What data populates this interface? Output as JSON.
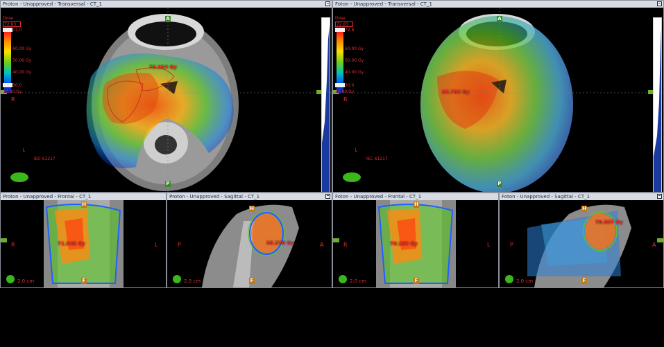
{
  "viewports": {
    "tl": {
      "title": "Proton  -  Unapproved - Transversal - CT_1",
      "dose_tag": "73.064 Gy"
    },
    "tr": {
      "title": "Foton  -  Unapproved - Transversal - CT_1",
      "dose_tag": "66.763 Gy"
    },
    "bl1": {
      "title": "Proton  -  Unapproved - Frontal - CT_1",
      "dose_tag": "71.948 Gy",
      "scale": "2.0 cm"
    },
    "bl2": {
      "title": "Proton  -  Unapproved - Sagittal - CT_1",
      "dose_tag": "68.370 Gy",
      "scale": "2.0 cm"
    },
    "br1": {
      "title": "Foton  -  Unapproved - Frontal - CT_1",
      "dose_tag": "70.286 Gy",
      "scale": "2.0 cm"
    },
    "br2": {
      "title": "Foton  -  Unapproved - Sagittal - CT_1",
      "dose_tag": "70.867 Gy",
      "scale": "2.0 cm"
    }
  },
  "legend_left": {
    "title": "Dose",
    "max_label": "72.83 Gy",
    "top": "72.0",
    "t60": "60.00 Gy",
    "t50": "50.00 Gy",
    "t40": "40.00 Gy",
    "bottom": "30.0",
    "min_label": "30.00 Gy"
  },
  "legend_right": {
    "title": "Dose",
    "max_label": "72.83 Gy",
    "top": "72.8",
    "t60": "60.00 Gy",
    "t50": "50.00 Gy",
    "t40": "40.00 Gy",
    "bottom": "30.0",
    "min_label": "30.00 Gy"
  },
  "orient": {
    "A": "A",
    "P": "P",
    "R": "R",
    "L": "L",
    "H": "H",
    "F": "F",
    "iec": "IEC 61217"
  },
  "colors": {
    "dose_red": "#ff2020",
    "label_red": "#e03030",
    "title_bg": "#d6dbe4",
    "marker_green": "#6fae2c"
  }
}
